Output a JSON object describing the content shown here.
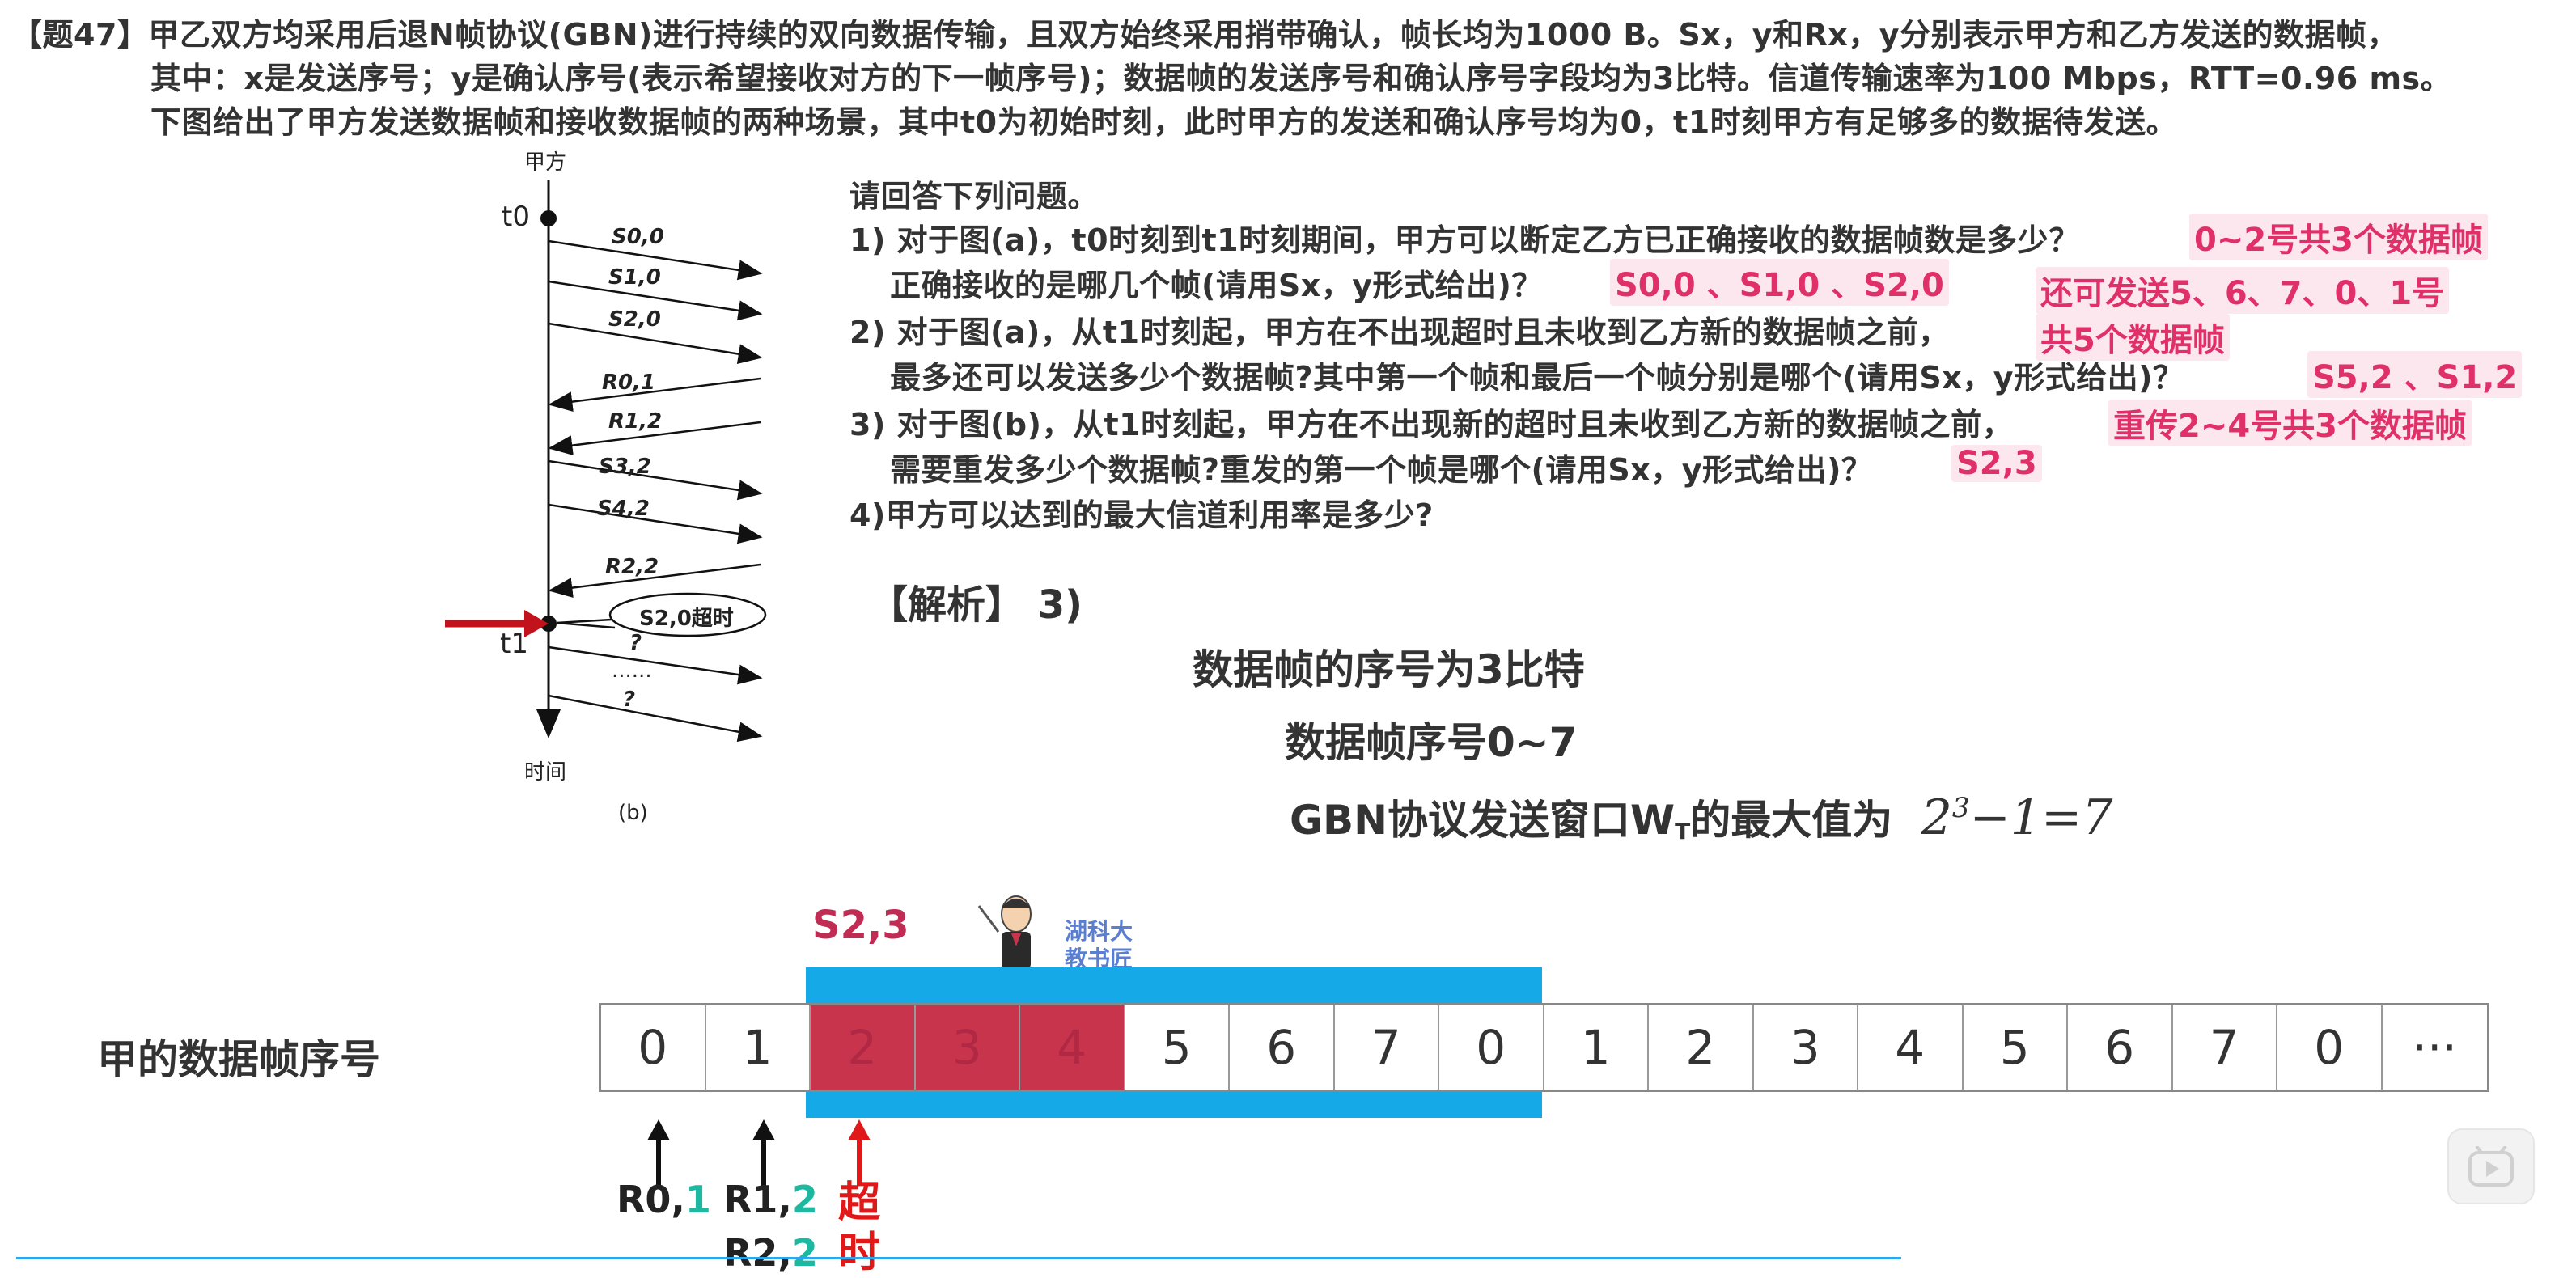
{
  "problem": {
    "line1": "【题47】甲乙双方均采用后退N帧协议(GBN)进行持续的双向数据传输，且双方始终采用捎带确认，帧长均为1000 B。Sx，y和Rx，y分别表示甲方和乙方发送的数据帧，",
    "line2": "其中：x是发送序号；y是确认序号(表示希望接收对方的下一帧序号)；数据帧的发送序号和确认序号字段均为3比特。信道传输速率为100 Mbps，RTT=0.96 ms。",
    "line3": "下图给出了甲方发送数据帧和接收数据帧的两种场景，其中t0为初始时刻，此时甲方的发送和确认序号均为0，t1时刻甲方有足够多的数据待发送。"
  },
  "diagram": {
    "top_label": "甲方",
    "bottom_label": "时间",
    "caption": "(b)",
    "t0": "t0",
    "t1": "t1",
    "timeout_bubble": "S2,0超时",
    "frames": [
      "S0,0",
      "S1,0",
      "S2,0",
      "R0,1",
      "R1,2",
      "S3,2",
      "S4,2",
      "R2,2",
      "?",
      "......",
      "?"
    ]
  },
  "questions": {
    "intro": "请回答下列问题。",
    "q1a": "1) 对于图(a)，t0时刻到t1时刻期间，甲方可以断定乙方已正确接收的数据帧数是多少？",
    "q1b": "正确接收的是哪几个帧(请用Sx，y形式给出)？",
    "q2a": "2) 对于图(a)，从t1时刻起，甲方在不出现超时且未收到乙方新的数据帧之前，",
    "q2b": "最多还可以发送多少个数据帧?其中第一个帧和最后一个帧分别是哪个(请用Sx，y形式给出)？",
    "q3a": "3) 对于图(b)，从t1时刻起，甲方在不出现新的超时且未收到乙方新的数据帧之前，",
    "q3b": "需要重发多少个数据帧?重发的第一个帧是哪个(请用Sx，y形式给出)？",
    "q4": "4)甲方可以达到的最大信道利用率是多少?"
  },
  "answers": {
    "a1_count": "0~2号共3个数据帧",
    "a1_frames": "S0,0 、S1,0 、S2,0",
    "a2_range": "还可发送5、6、7、0、1号",
    "a2_count": "共5个数据帧",
    "a2_frames": "S5,2 、S1,2",
    "a3_count": "重传2~4号共3个数据帧",
    "a3_frame": "S2,3"
  },
  "analysis": {
    "heading": "【解析】 3)",
    "line1": "数据帧的序号为3比特",
    "line2": "数据帧序号0~7",
    "line3": "GBN协议发送窗口W",
    "line3_sub": "T",
    "line3_tail": "的最大值为",
    "formula_base": "2",
    "formula_exp": "3",
    "formula_rest": "−1=7"
  },
  "strip": {
    "label": "甲的数据帧序号",
    "top_tag": "S2,3",
    "watermark": [
      "湖科大",
      "教书匠"
    ],
    "cells": [
      "0",
      "1",
      "2",
      "3",
      "4",
      "5",
      "6",
      "7",
      "0",
      "1",
      "2",
      "3",
      "4",
      "5",
      "6",
      "7",
      "0",
      "···"
    ],
    "ack1_prefix": "R0,",
    "ack1_num": "1",
    "ack2_prefix": "R1,",
    "ack2_num": "2",
    "ack3_prefix": "R2,",
    "ack3_num": "2",
    "timeout_label": [
      "超",
      "时"
    ]
  },
  "colors": {
    "accent_pink": "#e0306a",
    "highlight_red": "#c8344c",
    "window_blue": "#15a9e8",
    "teal": "#1cb8a0"
  }
}
